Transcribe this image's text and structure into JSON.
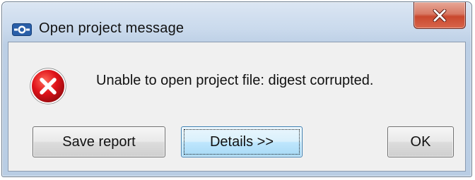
{
  "window": {
    "title": "Open project message",
    "app_icon": "app-logo-icon",
    "close_icon": "close-icon"
  },
  "dialog": {
    "icon": "error-icon",
    "message": "Unable to open project file: digest corrupted."
  },
  "buttons": {
    "save_report": "Save report",
    "details": "Details >>",
    "ok": "OK"
  },
  "colors": {
    "error_red": "#d8131a",
    "close_button": "#c9482e",
    "focused_button_border": "#3c7fb1"
  }
}
